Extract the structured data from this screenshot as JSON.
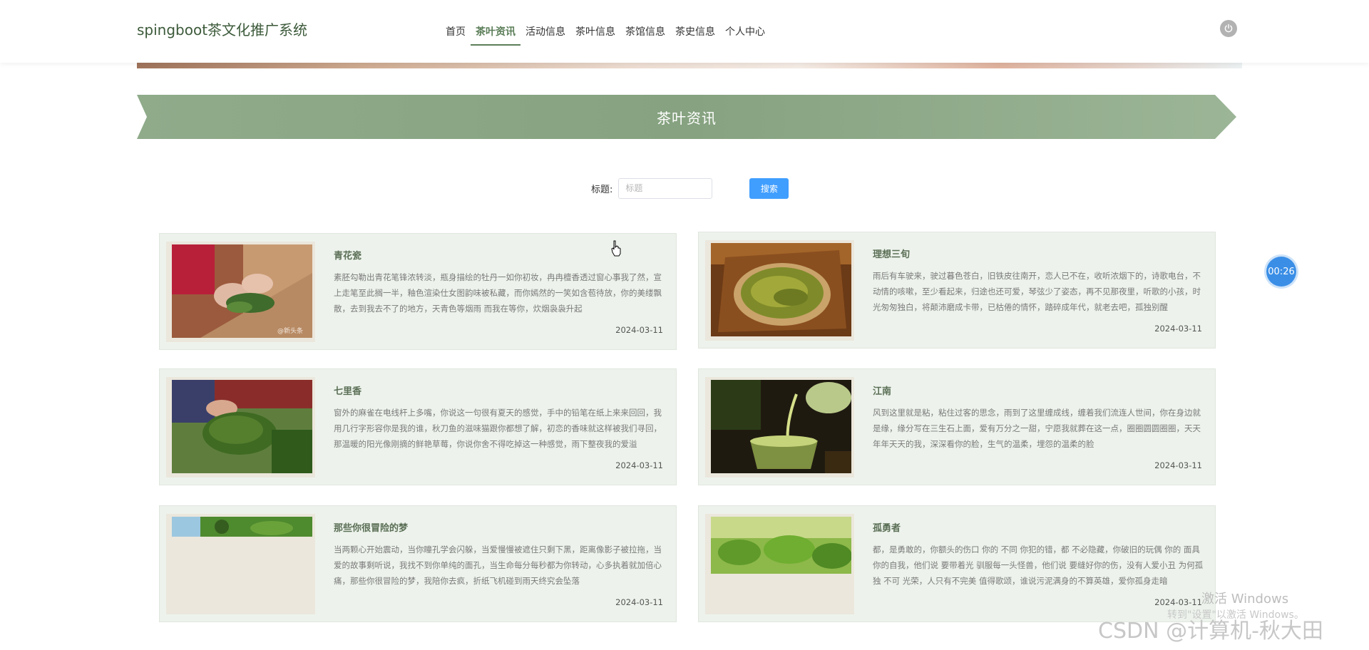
{
  "brand": "spingboot茶文化推广系统",
  "nav": {
    "items": [
      "首页",
      "茶叶资讯",
      "活动信息",
      "茶叶信息",
      "茶馆信息",
      "茶史信息",
      "个人中心"
    ],
    "active_index": 1
  },
  "section_title": "茶叶资讯",
  "search": {
    "label": "标题:",
    "placeholder": "标题",
    "value": "",
    "button": "搜索"
  },
  "cards": [
    {
      "title": "青花瓷",
      "body": "素胚勾勒出青花笔锋浓转淡，瓶身描绘的牡丹一如你初妆，冉冉檀香透过窗心事我了然，宣上走笔至此搁一半，釉色渲染仕女图韵味被私藏，而你嫣然的一笑如含苞待放，你的美缕飘散，去到我去不了的地方，天青色等烟雨 而我在等你，炊烟袅袅升起",
      "date": "2024-03-11",
      "image": "tea-picking-hands",
      "watermark": "@新头条"
    },
    {
      "title": "理想三旬",
      "body": "雨后有车驶来，驶过暮色苍白，旧铁皮往南开，恋人已不在，收听浓烟下的，诗歌电台，不动情的咳嗽，至少看起来，归途也还可爱，琴弦少了姿态，再不见那夜里，听歌的小孩，时光匆匆独白，将颠沛磨成卡带，已枯倦的情怀，踏碎成年代，就老去吧，孤独别醒",
      "date": "2024-03-11",
      "image": "green-tea-leaves-plate"
    },
    {
      "title": "七里香",
      "body": "窗外的麻雀在电线杆上多嘴，你说这一句很有夏天的感觉，手中的铅笔在纸上来来回回，我用几行字形容你是我的谁，秋刀鱼的滋味猫跟你都想了解，初恋的香味就这样被我们寻回，那温暖的阳光像刚摘的鲜艳草莓，你说你舍不得吃掉这一种感觉，雨下整夜我的爱溢",
      "date": "2024-03-11",
      "image": "tea-leaves-rolling"
    },
    {
      "title": "江南",
      "body": "风到这里就是粘，粘住过客的思念，雨到了这里缠成线，缠着我们流连人世间，你在身边就是缘，缘分写在三生石上面，爱有万分之一甜，宁愿我就葬在这一点，圈圈圆圆圈圈，天天年年天天的我，深深看你的脸，生气的温柔，埋怨的温柔的脸",
      "date": "2024-03-11",
      "image": "pouring-tea-cup"
    },
    {
      "title": "那些你很冒险的梦",
      "body": "当两颗心开始震动，当你瞳孔学会闪躲，当爱慢慢被遮住只剩下黑，距离像影子被拉拖，当爱的故事剩听说，我找不到你单纯的面孔，当生命每分每秒都为你转动，心多执着就加倍心痛，那些你很冒险的梦，我陪你去疯，折纸飞机碰到雨天终究会坠落",
      "date": "2024-03-11",
      "image": "tea-field"
    },
    {
      "title": "孤勇者",
      "body": "都，是勇敢的，你额头的伤口 你的 不同 你犯的错，都 不必隐藏，你破旧的玩偶 你的 面具 你的自我，他们说 要带着光 驯服每一头怪兽，他们说 要缝好你的伤，没有人爱小丑 为何孤独 不可 光荣，人只有不完美 值得歌颂，谁说污泥满身的不算英雄，爱你孤身走暗",
      "date": "2024-03-11",
      "image": "tea-buds"
    }
  ],
  "overlays": {
    "timer": "00:26",
    "windows_activation": "激活 Windows",
    "windows_activation_sub": "转到\"设置\"以激活 Windows。",
    "csdn_watermark": "CSDN @计算机-秋大田"
  },
  "colors": {
    "brand_green": "#5b7e58",
    "ribbon_green": "#8aa584",
    "card_bg": "#edf3ec",
    "search_button": "#409eff"
  }
}
